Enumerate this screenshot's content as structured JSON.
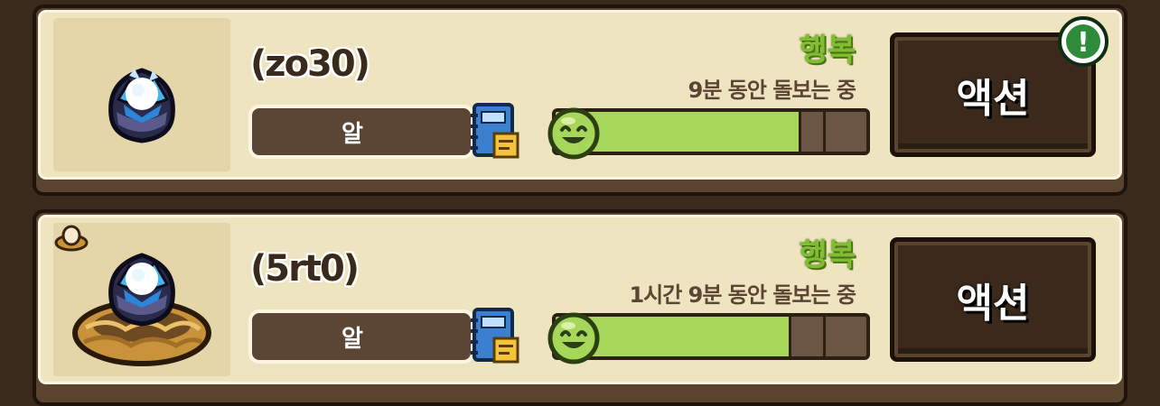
{
  "pets": [
    {
      "name": "(zo30)",
      "type": "알",
      "mood": "행복",
      "care_time": "9분 동안 돌보는 중",
      "happiness": 0.79,
      "action_label": "액션",
      "has_alert": true,
      "alert_symbol": "!",
      "has_nest": false
    },
    {
      "name": "(5rt0)",
      "type": "알",
      "mood": "행복",
      "care_time": "1시간 9분 동안 돌보는 중",
      "happiness": 0.76,
      "action_label": "액션",
      "has_alert": false,
      "has_nest": true
    }
  ],
  "icons": {
    "portrait": "blue-crystal-egg-icon",
    "nest": "straw-nest-icon",
    "mini_egg": "egg-in-nest-icon",
    "journal": "journal-book-icon",
    "mood": "green-smiley-icon",
    "alert": "alert-exclamation-icon"
  },
  "colors": {
    "mood_text": "#7fbf2e",
    "bar_fill": "#a6d65a",
    "alert_green": "#2e8b3a",
    "card_bg": "#efe4c0",
    "button_bg": "#3b2a1c"
  }
}
